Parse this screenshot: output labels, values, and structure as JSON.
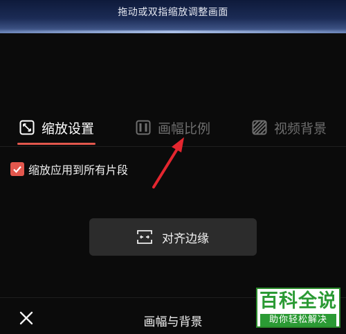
{
  "preview": {
    "hint": "拖动或双指缩放调整画面"
  },
  "tabs": [
    {
      "label": "缩放设置",
      "icon": "zoom-icon",
      "active": true
    },
    {
      "label": "画幅比例",
      "icon": "aspect-ratio-icon",
      "active": false
    },
    {
      "label": "视频背景",
      "icon": "background-icon",
      "active": false
    }
  ],
  "options": {
    "apply_all_label": "缩放应用到所有片段",
    "apply_all_checked": true
  },
  "align_button": {
    "label": "对齐边缘",
    "icon": "align-edges-icon"
  },
  "bottom_bar": {
    "title": "画幅与背景",
    "close_icon": "close-icon"
  },
  "watermark": {
    "title": "百科全说",
    "subtitle": "助你轻松解决"
  },
  "colors": {
    "accent": "#e3574d",
    "watermark_green": "#2b9a34"
  }
}
